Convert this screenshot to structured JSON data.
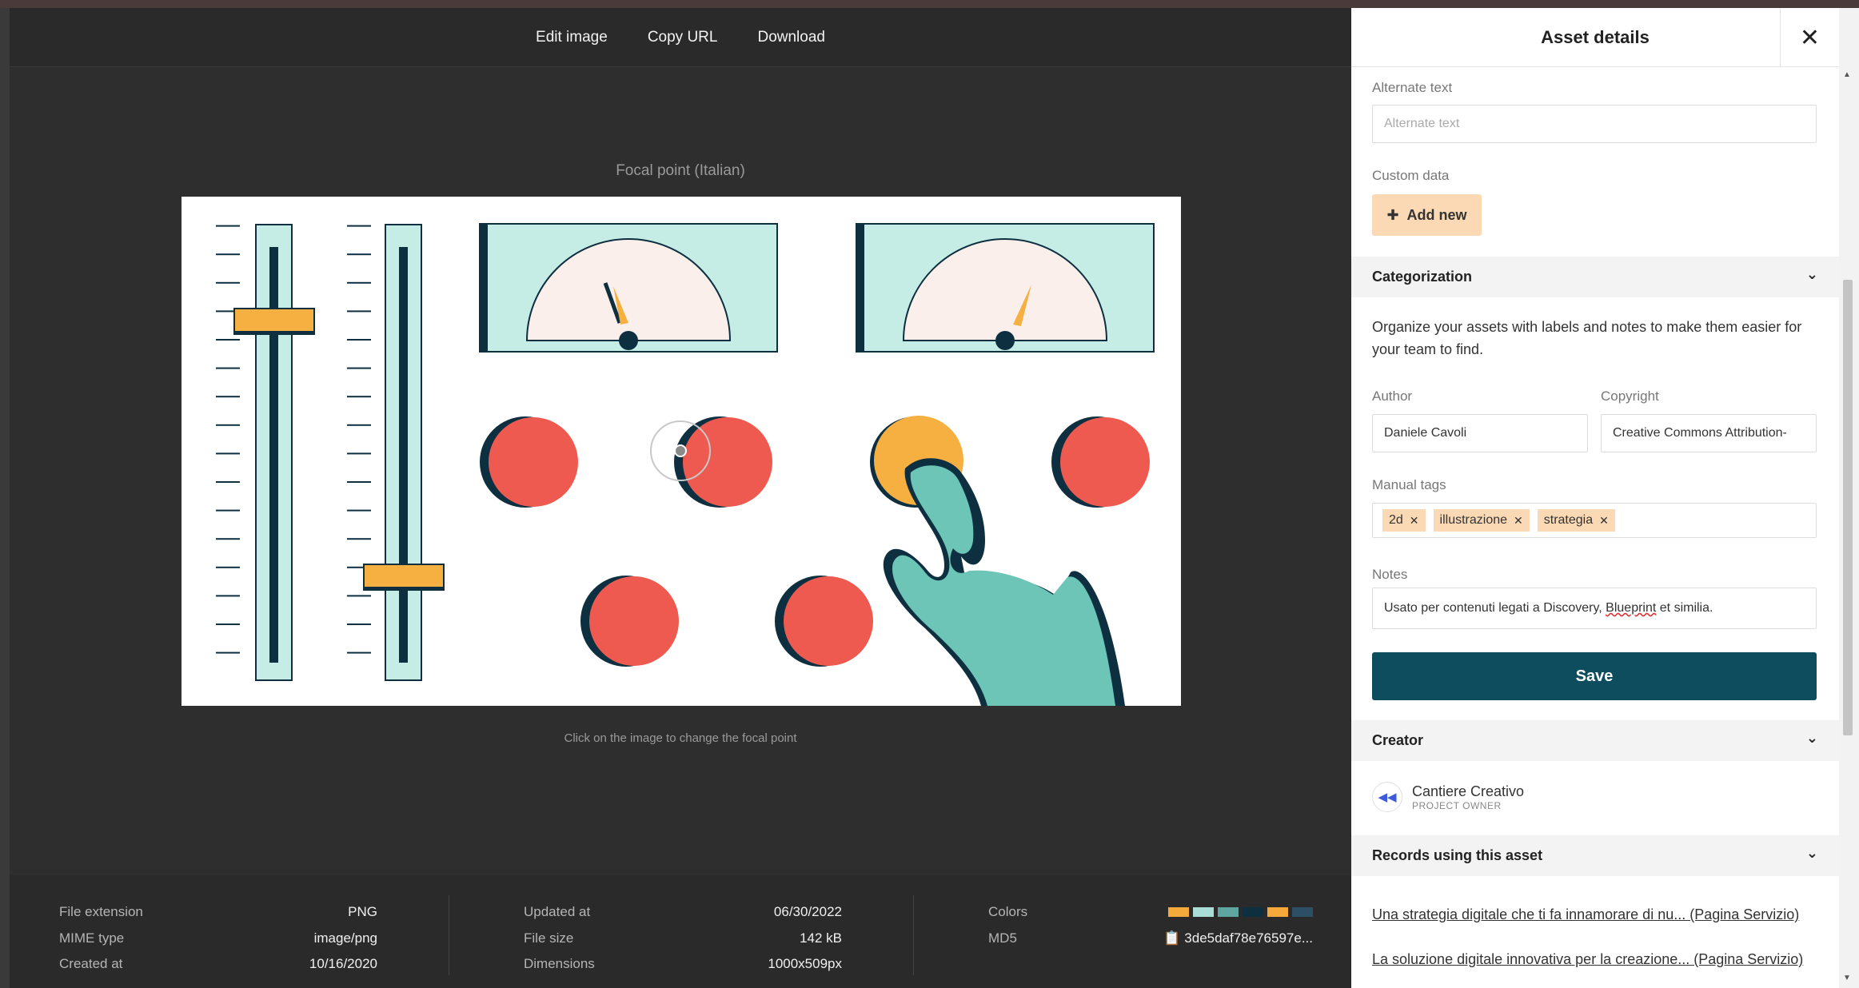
{
  "toolbar": {
    "edit_image": "Edit image",
    "copy_url": "Copy URL",
    "download": "Download"
  },
  "viewer": {
    "focal_title": "Focal point (Italian)",
    "focal_hint": "Click on the image to change the focal point"
  },
  "meta": {
    "file_extension_label": "File extension",
    "file_extension": "PNG",
    "mime_label": "MIME type",
    "mime": "image/png",
    "created_label": "Created at",
    "created": "10/16/2020",
    "updated_label": "Updated at",
    "updated": "06/30/2022",
    "size_label": "File size",
    "size": "142 kB",
    "dimensions_label": "Dimensions",
    "dimensions": "1000x509px",
    "colors_label": "Colors",
    "colors": [
      "#f5a93a",
      "#a9ddd6",
      "#5fa6a0",
      "#0d2f3f",
      "#f5a93a",
      "#2d4f66"
    ],
    "md5_label": "MD5",
    "md5": "3de5daf78e76597e..."
  },
  "panel": {
    "title": "Asset details",
    "alt_label": "Alternate text",
    "alt_placeholder": "Alternate text",
    "custom_label": "Custom data",
    "add_new": "Add new",
    "categorization": "Categorization",
    "categorization_desc": "Organize your assets with labels and notes to make them easier for your team to find.",
    "author_label": "Author",
    "author": "Daniele Cavoli",
    "copyright_label": "Copyright",
    "copyright": "Creative Commons Attribution-",
    "tags_label": "Manual tags",
    "tags": [
      "2d",
      "illustrazione",
      "strategia"
    ],
    "notes_label": "Notes",
    "notes_before": "Usato per contenuti legati a Discovery, ",
    "notes_flag": "Blueprint",
    "notes_after": " et similia.",
    "save": "Save",
    "creator_section": "Creator",
    "creator_name": "Cantiere Creativo",
    "creator_role": "PROJECT OWNER",
    "records_section": "Records using this asset",
    "records": [
      "Una strategia digitale che ti fa innamorare di nu... (Pagina Servizio)",
      "La soluzione digitale innovativa per la creazione... (Pagina Servizio)"
    ]
  }
}
